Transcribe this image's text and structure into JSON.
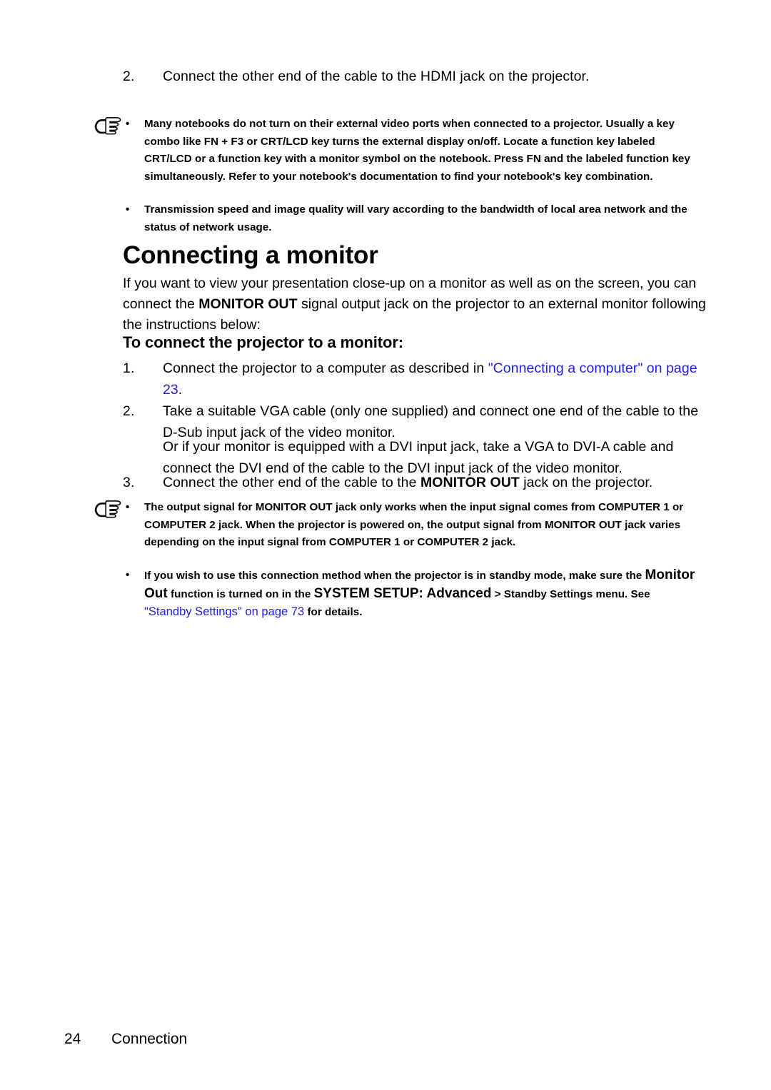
{
  "page": {
    "footer_page_number": "24",
    "footer_section": "Connection",
    "link_color": "#2020e0"
  },
  "icons": {
    "note": "pointing-hand-icon",
    "bullet": "•"
  },
  "top_step": {
    "number": "2.",
    "text": "Connect the other end of the cable to the HDMI jack on the projector."
  },
  "note_block_1": {
    "items": [
      {
        "bullet": "•",
        "has_icon": true,
        "runs": [
          {
            "text": "Many notebooks do not turn on their external video ports when connected to a projector. Usually a key combo like FN + F3 or CRT/LCD key turns the external display on/off. Locate a function key labeled CRT/LCD or a function key with a monitor symbol on the notebook. Press FN and the labeled function key simultaneously. Refer to your notebook's documentation to find your notebook's key combination."
          }
        ]
      },
      {
        "bullet": "•",
        "has_icon": false,
        "runs": [
          {
            "text": "Transmission speed and image quality will vary according to the bandwidth of local area network and the status of network usage."
          }
        ]
      }
    ]
  },
  "heading": "Connecting a monitor",
  "intro": {
    "part1": "If you want to view your presentation close-up on a monitor as well as on the screen, you can connect the ",
    "bold1": "MONITOR OUT",
    "part2": " signal output jack on the projector to an external monitor following the instructions below:"
  },
  "subheading": "To connect the projector to a monitor:",
  "steps": [
    {
      "number": "1.",
      "part1": "Connect the projector to a computer as described in ",
      "link": "\"Connecting a computer\" on page 23",
      "part2": "."
    },
    {
      "number": "2.",
      "part1": "Take a suitable VGA cable (only one supplied) and connect one end of the cable to the D-Sub input jack of the video monitor.",
      "link": "",
      "part2": ""
    },
    {
      "number": "3.",
      "part1": "Connect the other end of the cable to the ",
      "bold": "MONITOR OUT",
      "part2": " jack on the projector."
    }
  ],
  "step_continuation": "Or if your monitor is equipped with a DVI input jack, take a VGA to DVI-A cable and connect the DVI end of the cable to the DVI input jack of the video monitor.",
  "note_block_2": {
    "items": [
      {
        "bullet": "•",
        "has_icon": true,
        "text_a": "The output signal for ",
        "bold_a": "MONITOR OUT",
        "text_b": " jack only works when the input signal comes from ",
        "bold_b": "COMPUTER 1",
        "text_c": " or ",
        "bold_c": "COMPUTER 2",
        "text_d": " jack. When the projector is powered on, the output signal from ",
        "bold_d": "MONITOR OUT",
        "text_e": " jack varies depending on the input signal from ",
        "bold_e": "COMPUTER 1",
        "text_f": " or ",
        "bold_f": "COMPUTER 2",
        "text_g": " jack."
      },
      {
        "bullet": "•",
        "has_icon": false,
        "text_a": "If you wish to use this connection method when the projector is in standby mode, make sure the ",
        "big_a": "Monitor Out",
        "text_b": " function is turned on in the ",
        "big_b": "SYSTEM SETUP: Advanced",
        "text_c": " > Standby Settings menu. See ",
        "link": "\"Standby Settings\" on page 73",
        "text_d": " for details."
      }
    ]
  }
}
